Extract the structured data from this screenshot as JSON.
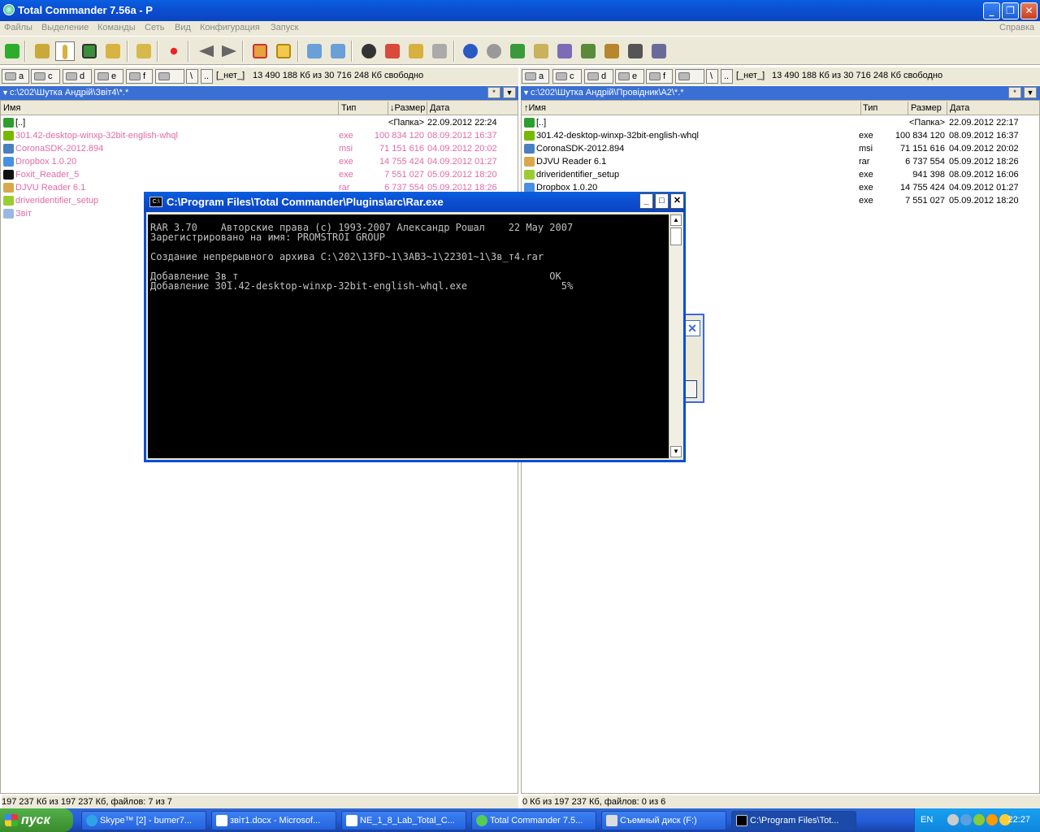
{
  "window": {
    "title": "Total Commander 7.56a - P"
  },
  "menu": {
    "items": [
      "Файлы",
      "Выделение",
      "Команды",
      "Сеть",
      "Вид",
      "Конфигурация",
      "Запуск"
    ],
    "help": "Справка"
  },
  "drives": [
    "a",
    "c",
    "d",
    "e",
    "f",
    "\\",
    ".."
  ],
  "left": {
    "drive_label": "[_нет_]",
    "free": "13 490 188 Кб из 30 716 248 Кб свободно",
    "path": "c:\\202\\Шутка Андрій\\Звіт4\\*.*",
    "columns": {
      "name": "Имя",
      "type": "Тип",
      "size": "↓Размер",
      "date": "Дата"
    },
    "rows": [
      {
        "name": "[..]",
        "type": "",
        "size": "<Папка>",
        "date": "22.09.2012 22:24",
        "style": "normal",
        "icon": "up-arrow-icon"
      },
      {
        "name": "301.42-desktop-winxp-32bit-english-whql",
        "type": "exe",
        "size": "100 834 120",
        "date": "08.09.2012 16:37",
        "style": "pink",
        "icon": "nvidia-icon"
      },
      {
        "name": "CoronaSDK-2012.894",
        "type": "msi",
        "size": "71 151 616",
        "date": "04.09.2012 20:02",
        "style": "pink",
        "icon": "msi-icon"
      },
      {
        "name": "Dropbox 1.0.20",
        "type": "exe",
        "size": "14 755 424",
        "date": "04.09.2012 01:27",
        "style": "pink",
        "icon": "dropbox-icon"
      },
      {
        "name": "Foxit_Reader_5",
        "type": "exe",
        "size": "7 551 027",
        "date": "05.09.2012 18:20",
        "style": "pink",
        "icon": "7z-icon"
      },
      {
        "name": "DJVU Reader 6.1",
        "type": "rar",
        "size": "6 737 554",
        "date": "05.09.2012 18:26",
        "style": "pink",
        "icon": "rar-icon"
      },
      {
        "name": "driveridentifier_setup",
        "type": "",
        "size": "",
        "date": "",
        "style": "pink",
        "icon": "setup-icon"
      },
      {
        "name": "Звіт",
        "type": "",
        "size": "",
        "date": "",
        "style": "pink",
        "icon": "file-icon"
      }
    ],
    "status": "197 237 Кб из 197 237 Кб, файлов: 7 из 7"
  },
  "right": {
    "drive_label": "[_нет_]",
    "free": "13 490 188 Кб из 30 716 248 Кб свободно",
    "path": "c:\\202\\Шутка Андрій\\Провідник\\A2\\*.*",
    "columns": {
      "name": "↑Имя",
      "type": "Тип",
      "size": "Размер",
      "date": "Дата"
    },
    "rows": [
      {
        "name": "[..]",
        "type": "",
        "size": "<Папка>",
        "date": "22.09.2012 22:17",
        "style": "normal",
        "icon": "up-arrow-icon"
      },
      {
        "name": "301.42-desktop-winxp-32bit-english-whql",
        "type": "exe",
        "size": "100 834 120",
        "date": "08.09.2012 16:37",
        "style": "normal",
        "icon": "nvidia-icon"
      },
      {
        "name": "CoronaSDK-2012.894",
        "type": "msi",
        "size": "71 151 616",
        "date": "04.09.2012 20:02",
        "style": "normal",
        "icon": "msi-icon"
      },
      {
        "name": "DJVU Reader 6.1",
        "type": "rar",
        "size": "6 737 554",
        "date": "05.09.2012 18:26",
        "style": "normal",
        "icon": "rar-icon"
      },
      {
        "name": "driveridentifier_setup",
        "type": "exe",
        "size": "941 398",
        "date": "08.09.2012 16:06",
        "style": "normal",
        "icon": "setup-icon"
      },
      {
        "name": "Dropbox 1.0.20",
        "type": "exe",
        "size": "14 755 424",
        "date": "04.09.2012 01:27",
        "style": "normal",
        "icon": "dropbox-icon"
      },
      {
        "name": "",
        "type": "exe",
        "size": "7 551 027",
        "date": "05.09.2012 18:20",
        "style": "normal",
        "icon": ""
      }
    ],
    "status": "0 Кб из 197 237 Кб, файлов: 0 из 6"
  },
  "console": {
    "title": "C:\\Program Files\\Total Commander\\Plugins\\arc\\Rar.exe",
    "lines": [
      "RAR 3.70    Авторские права (c) 1993-2007 Александр Рошал    22 May 2007",
      "Зарегистрировано на имя: PROMSTROI GROUP",
      "",
      "Создание непрерывного архива C:\\202\\13FD~1\\3AB3~1\\22301~1\\3в_т4.rar",
      "",
      "Добавление 3в_т                                                     OK",
      "Добавление 301.42-desktop-winxp-32bit-english-whql.exe                5%"
    ]
  },
  "taskbar": {
    "start": "пуск",
    "tasks": [
      {
        "label": "Skype™ [2] - bumer7...",
        "icon": "skype-icon"
      },
      {
        "label": "звіт1.docx - Microsof...",
        "icon": "word-icon"
      },
      {
        "label": "NE_1_8_Lab_Total_C...",
        "icon": "word-icon"
      },
      {
        "label": "Total Commander 7.5...",
        "icon": "totalcmd-icon"
      },
      {
        "label": "Съемный диск (F:)",
        "icon": "folder-icon"
      },
      {
        "label": "C:\\Program Files\\Tot...",
        "icon": "console-icon"
      }
    ],
    "lang": "EN",
    "clock": "22:27"
  },
  "colors": {
    "accent": "#0b4fd1",
    "pink_text": "#e26aa8",
    "path_bar": "#3a6fd4"
  }
}
